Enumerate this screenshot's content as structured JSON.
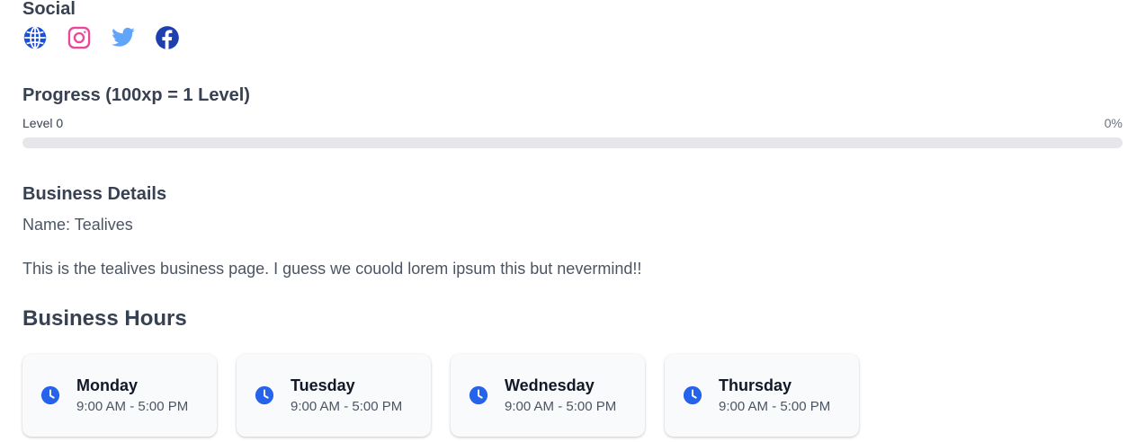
{
  "social": {
    "title": "Social",
    "icons": [
      "globe-icon",
      "instagram-icon",
      "twitter-icon",
      "facebook-icon"
    ]
  },
  "progress": {
    "title": "Progress (100xp = 1 Level)",
    "level_label": "Level 0",
    "percent_label": "0%",
    "fraction": 0
  },
  "business": {
    "title": "Business Details",
    "name": "Name: Tealives",
    "description": "This is the tealives business page. I guess we couold lorem ipsum this but nevermind!!"
  },
  "hours": {
    "title": "Business Hours",
    "days": [
      {
        "day": "Monday",
        "time": "9:00 AM - 5:00 PM"
      },
      {
        "day": "Tuesday",
        "time": "9:00 AM - 5:00 PM"
      },
      {
        "day": "Wednesday",
        "time": "9:00 AM - 5:00 PM"
      },
      {
        "day": "Thursday",
        "time": "9:00 AM - 5:00 PM"
      }
    ]
  },
  "colors": {
    "globe": "#1d4ed8",
    "instagram": "#ec4899",
    "twitter": "#60a5fa",
    "facebook": "#1e40af",
    "clock": "#2563eb"
  }
}
